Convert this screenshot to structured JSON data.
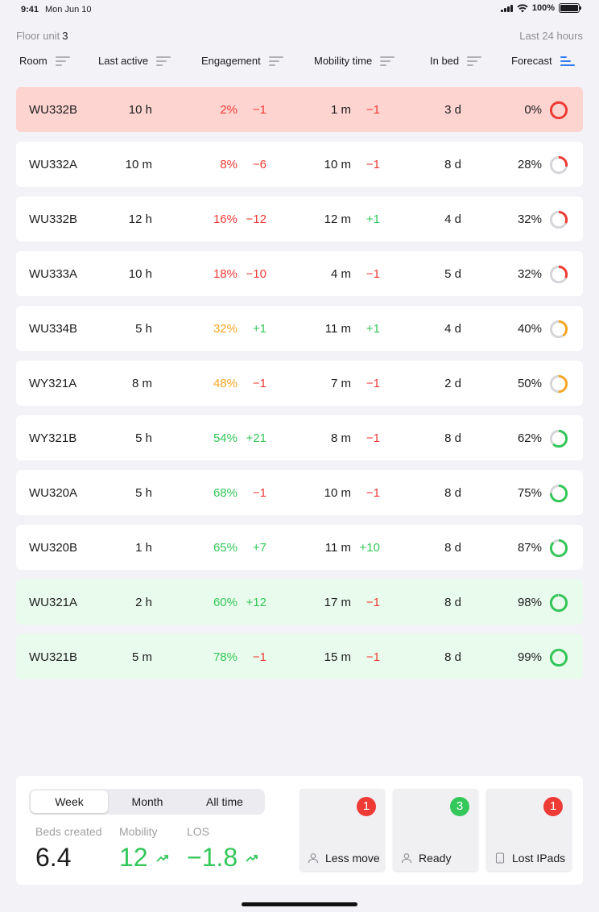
{
  "status_bar": {
    "time": "9:41",
    "date": "Mon Jun 10",
    "battery": "100%"
  },
  "header": {
    "floor_label": "Floor unit",
    "floor_number": "3",
    "range": "Last 24 hours"
  },
  "columns": [
    {
      "label": "Room",
      "sort_active": false
    },
    {
      "label": "Last active",
      "sort_active": false
    },
    {
      "label": "Engagement",
      "sort_active": false
    },
    {
      "label": "Mobility time",
      "sort_active": false
    },
    {
      "label": "In bed",
      "sort_active": false
    },
    {
      "label": "Forecast",
      "sort_active": true
    }
  ],
  "rows": [
    {
      "room": "WU332B",
      "last_active": "10 h",
      "engagement": "2%",
      "engagement_delta": "−1",
      "mobility": "1 m",
      "mobility_delta": "−1",
      "in_bed": "3 d",
      "forecast": "0%",
      "forecast_value": 0,
      "highlight": "red",
      "eng_color": "red",
      "engd_color": "red",
      "mobd_color": "red",
      "ring_color": "red"
    },
    {
      "room": "WU332A",
      "last_active": "10 m",
      "engagement": "8%",
      "engagement_delta": "−6",
      "mobility": "10 m",
      "mobility_delta": "−1",
      "in_bed": "8 d",
      "forecast": "28%",
      "forecast_value": 28,
      "highlight": "none",
      "eng_color": "red",
      "engd_color": "red",
      "mobd_color": "red",
      "ring_color": "red"
    },
    {
      "room": "WU332B",
      "last_active": "12 h",
      "engagement": "16%",
      "engagement_delta": "−12",
      "mobility": "12 m",
      "mobility_delta": "+1",
      "in_bed": "4 d",
      "forecast": "32%",
      "forecast_value": 32,
      "highlight": "none",
      "eng_color": "red",
      "engd_color": "red",
      "mobd_color": "green",
      "ring_color": "red"
    },
    {
      "room": "WU333A",
      "last_active": "10 h",
      "engagement": "18%",
      "engagement_delta": "−10",
      "mobility": "4 m",
      "mobility_delta": "−1",
      "in_bed": "5 d",
      "forecast": "32%",
      "forecast_value": 32,
      "highlight": "none",
      "eng_color": "red",
      "engd_color": "red",
      "mobd_color": "red",
      "ring_color": "red"
    },
    {
      "room": "WU334B",
      "last_active": "5 h",
      "engagement": "32%",
      "engagement_delta": "+1",
      "mobility": "11 m",
      "mobility_delta": "+1",
      "in_bed": "4 d",
      "forecast": "40%",
      "forecast_value": 40,
      "highlight": "none",
      "eng_color": "orange",
      "engd_color": "green",
      "mobd_color": "green",
      "ring_color": "orange"
    },
    {
      "room": "WY321A",
      "last_active": "8 m",
      "engagement": "48%",
      "engagement_delta": "−1",
      "mobility": "7 m",
      "mobility_delta": "−1",
      "in_bed": "2 d",
      "forecast": "50%",
      "forecast_value": 50,
      "highlight": "none",
      "eng_color": "orange",
      "engd_color": "red",
      "mobd_color": "red",
      "ring_color": "orange"
    },
    {
      "room": "WY321B",
      "last_active": "5 h",
      "engagement": "54%",
      "engagement_delta": "+21",
      "mobility": "8 m",
      "mobility_delta": "−1",
      "in_bed": "8 d",
      "forecast": "62%",
      "forecast_value": 62,
      "highlight": "none",
      "eng_color": "green",
      "engd_color": "green",
      "mobd_color": "red",
      "ring_color": "green"
    },
    {
      "room": "WU320A",
      "last_active": "5 h",
      "engagement": "68%",
      "engagement_delta": "−1",
      "mobility": "10 m",
      "mobility_delta": "−1",
      "in_bed": "8 d",
      "forecast": "75%",
      "forecast_value": 75,
      "highlight": "none",
      "eng_color": "green",
      "engd_color": "red",
      "mobd_color": "red",
      "ring_color": "green"
    },
    {
      "room": "WU320B",
      "last_active": "1 h",
      "engagement": "65%",
      "engagement_delta": "+7",
      "mobility": "11 m",
      "mobility_delta": "+10",
      "in_bed": "8 d",
      "forecast": "87%",
      "forecast_value": 87,
      "highlight": "none",
      "eng_color": "green",
      "engd_color": "green",
      "mobd_color": "green",
      "ring_color": "green"
    },
    {
      "room": "WU321A",
      "last_active": "2 h",
      "engagement": "60%",
      "engagement_delta": "+12",
      "mobility": "17 m",
      "mobility_delta": "−1",
      "in_bed": "8 d",
      "forecast": "98%",
      "forecast_value": 98,
      "highlight": "green",
      "eng_color": "green",
      "engd_color": "green",
      "mobd_color": "red",
      "ring_color": "green"
    },
    {
      "room": "WU321B",
      "last_active": "5 m",
      "engagement": "78%",
      "engagement_delta": "−1",
      "mobility": "15 m",
      "mobility_delta": "−1",
      "in_bed": "8 d",
      "forecast": "99%",
      "forecast_value": 99,
      "highlight": "green",
      "eng_color": "green",
      "engd_color": "red",
      "mobd_color": "red",
      "ring_color": "green"
    }
  ],
  "summary": {
    "tabs": [
      {
        "label": "Week",
        "selected": true
      },
      {
        "label": "Month",
        "selected": false
      },
      {
        "label": "All time",
        "selected": false
      }
    ],
    "metrics": [
      {
        "label": "Beds created",
        "value": "6.4",
        "trend": false,
        "color": "default"
      },
      {
        "label": "Mobility",
        "value": "12",
        "trend": true,
        "color": "green"
      },
      {
        "label": "LOS",
        "value": "−1.8",
        "trend": true,
        "color": "green"
      }
    ],
    "cards": [
      {
        "label": "Less move",
        "count": "1",
        "badge_color": "red",
        "icon": "person-icon"
      },
      {
        "label": "Ready",
        "count": "3",
        "badge_color": "green",
        "icon": "person-icon"
      },
      {
        "label": "Lost IPads",
        "count": "1",
        "badge_color": "red",
        "icon": "ipad-icon"
      }
    ]
  },
  "colors": {
    "red": "#ef3b36",
    "orange": "#f5a623",
    "green": "#34c759",
    "ring_track": "#d6d6da",
    "accent": "#2f7cf6"
  }
}
